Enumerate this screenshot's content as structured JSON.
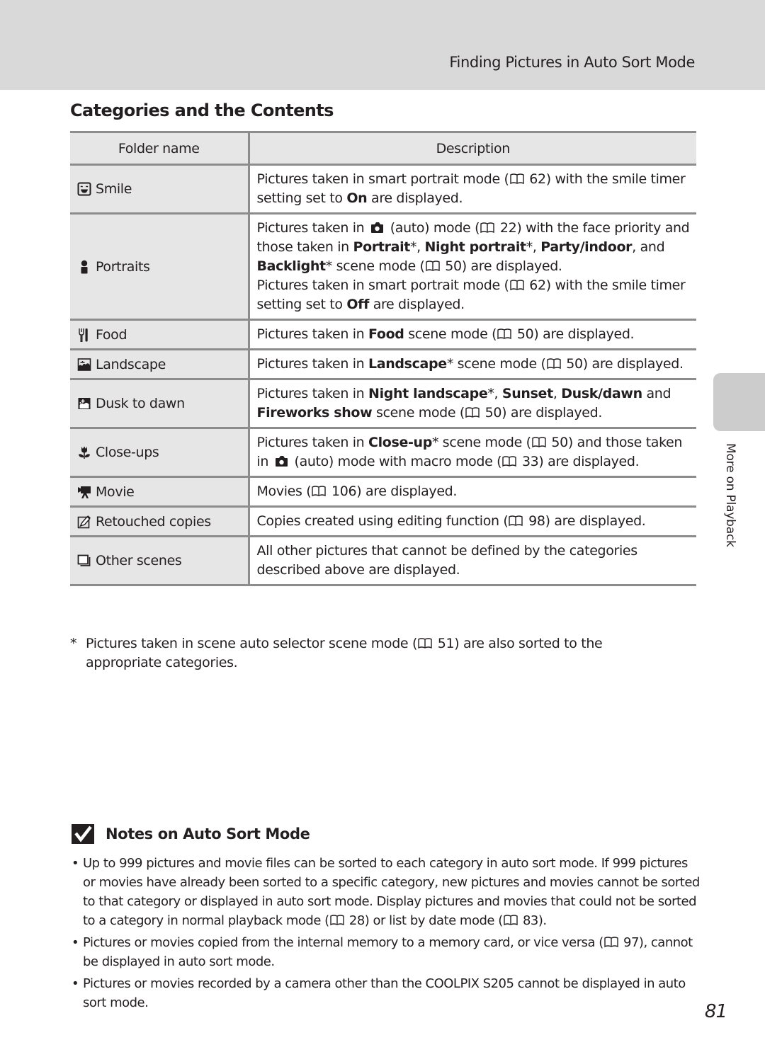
{
  "header": {
    "running_head": "Finding Pictures in Auto Sort Mode"
  },
  "section_title": "Categories and the Contents",
  "table": {
    "headers": [
      "Folder name",
      "Description"
    ],
    "rows": [
      {
        "icon": "smile-icon",
        "folder": "Smile",
        "description": [
          {
            "t": "Pictures taken in smart portrait mode ("
          },
          {
            "ref": "62"
          },
          {
            "t": ") with the smile timer setting set to "
          },
          {
            "b": "On"
          },
          {
            "t": " are displayed."
          }
        ]
      },
      {
        "icon": "portrait-icon",
        "folder": "Portraits",
        "description": [
          {
            "t": "Pictures taken in "
          },
          {
            "cam": "auto-mode-camera"
          },
          {
            "t": " (auto) mode ("
          },
          {
            "ref": "22"
          },
          {
            "t": ") with the face priority and those taken in "
          },
          {
            "b": "Portrait"
          },
          {
            "t": "*, "
          },
          {
            "b": "Night portrait"
          },
          {
            "t": "*, "
          },
          {
            "b": "Party/indoor"
          },
          {
            "t": ", and "
          },
          {
            "b": "Backlight"
          },
          {
            "t": "* scene mode ("
          },
          {
            "ref": "50"
          },
          {
            "t": ") are displayed."
          },
          {
            "br": true
          },
          {
            "t": "Pictures taken in smart portrait mode ("
          },
          {
            "ref": "62"
          },
          {
            "t": ") with the smile timer setting set to "
          },
          {
            "b": "Off"
          },
          {
            "t": " are displayed."
          }
        ]
      },
      {
        "icon": "food-icon",
        "folder": "Food",
        "description": [
          {
            "t": "Pictures taken in "
          },
          {
            "b": "Food"
          },
          {
            "t": " scene mode ("
          },
          {
            "ref": "50"
          },
          {
            "t": ") are displayed."
          }
        ]
      },
      {
        "icon": "landscape-icon",
        "folder": "Landscape",
        "description": [
          {
            "t": "Pictures taken in "
          },
          {
            "b": "Landscape"
          },
          {
            "t": "* scene mode ("
          },
          {
            "ref": "50"
          },
          {
            "t": ") are displayed."
          }
        ]
      },
      {
        "icon": "dusk-to-dawn-icon",
        "folder": "Dusk to dawn",
        "description": [
          {
            "t": "Pictures taken in "
          },
          {
            "b": "Night landscape"
          },
          {
            "t": "*, "
          },
          {
            "b": "Sunset"
          },
          {
            "t": ", "
          },
          {
            "b": "Dusk/dawn"
          },
          {
            "t": " and "
          },
          {
            "b": "Fireworks show"
          },
          {
            "t": " scene mode ("
          },
          {
            "ref": "50"
          },
          {
            "t": ") are displayed."
          }
        ]
      },
      {
        "icon": "close-up-flower-icon",
        "folder": "Close-ups",
        "description": [
          {
            "t": "Pictures taken in "
          },
          {
            "b": "Close-up"
          },
          {
            "t": "* scene mode ("
          },
          {
            "ref": "50"
          },
          {
            "t": ") and those taken in "
          },
          {
            "cam": "auto-mode-camera"
          },
          {
            "t": " (auto) mode with macro mode ("
          },
          {
            "ref": "33"
          },
          {
            "t": ") are displayed."
          }
        ]
      },
      {
        "icon": "movie-camera-icon",
        "folder": "Movie",
        "description": [
          {
            "t": "Movies ("
          },
          {
            "ref": "106"
          },
          {
            "t": ") are displayed."
          }
        ]
      },
      {
        "icon": "retouch-icon",
        "folder": "Retouched copies",
        "description": [
          {
            "t": "Copies created using editing function ("
          },
          {
            "ref": "98"
          },
          {
            "t": ") are displayed."
          }
        ]
      },
      {
        "icon": "other-scenes-icon",
        "folder": "Other scenes",
        "description": [
          {
            "t": "All other pictures that cannot be defined by the categories described above are displayed."
          }
        ]
      }
    ]
  },
  "footnote": {
    "marker": "*",
    "text": [
      {
        "t": "Pictures taken in scene auto selector scene mode ("
      },
      {
        "ref": "51"
      },
      {
        "t": ") are also sorted to the appropriate categories."
      }
    ]
  },
  "side_tab": {
    "label": "More on Playback"
  },
  "notes": {
    "icon": "checkmark-icon",
    "title": "Notes on Auto Sort Mode",
    "items": [
      [
        {
          "t": "Up to 999 pictures and movie files can be sorted to each category in auto sort mode. If 999 pictures or movies have already been sorted to a specific category, new pictures and movies cannot be sorted to that category or displayed in auto sort mode. Display pictures and movies that could not be sorted to a category in normal playback mode ("
        },
        {
          "ref": "28"
        },
        {
          "t": ") or list by date mode ("
        },
        {
          "ref": "83"
        },
        {
          "t": ")."
        }
      ],
      [
        {
          "t": "Pictures or movies copied from the internal memory to a memory card, or vice versa ("
        },
        {
          "ref": "97"
        },
        {
          "t": "), cannot be displayed in auto sort mode."
        }
      ],
      [
        {
          "t": "Pictures or movies recorded by a camera other than the COOLPIX S205 cannot be displayed in auto sort mode."
        }
      ]
    ]
  },
  "page_number": "81"
}
